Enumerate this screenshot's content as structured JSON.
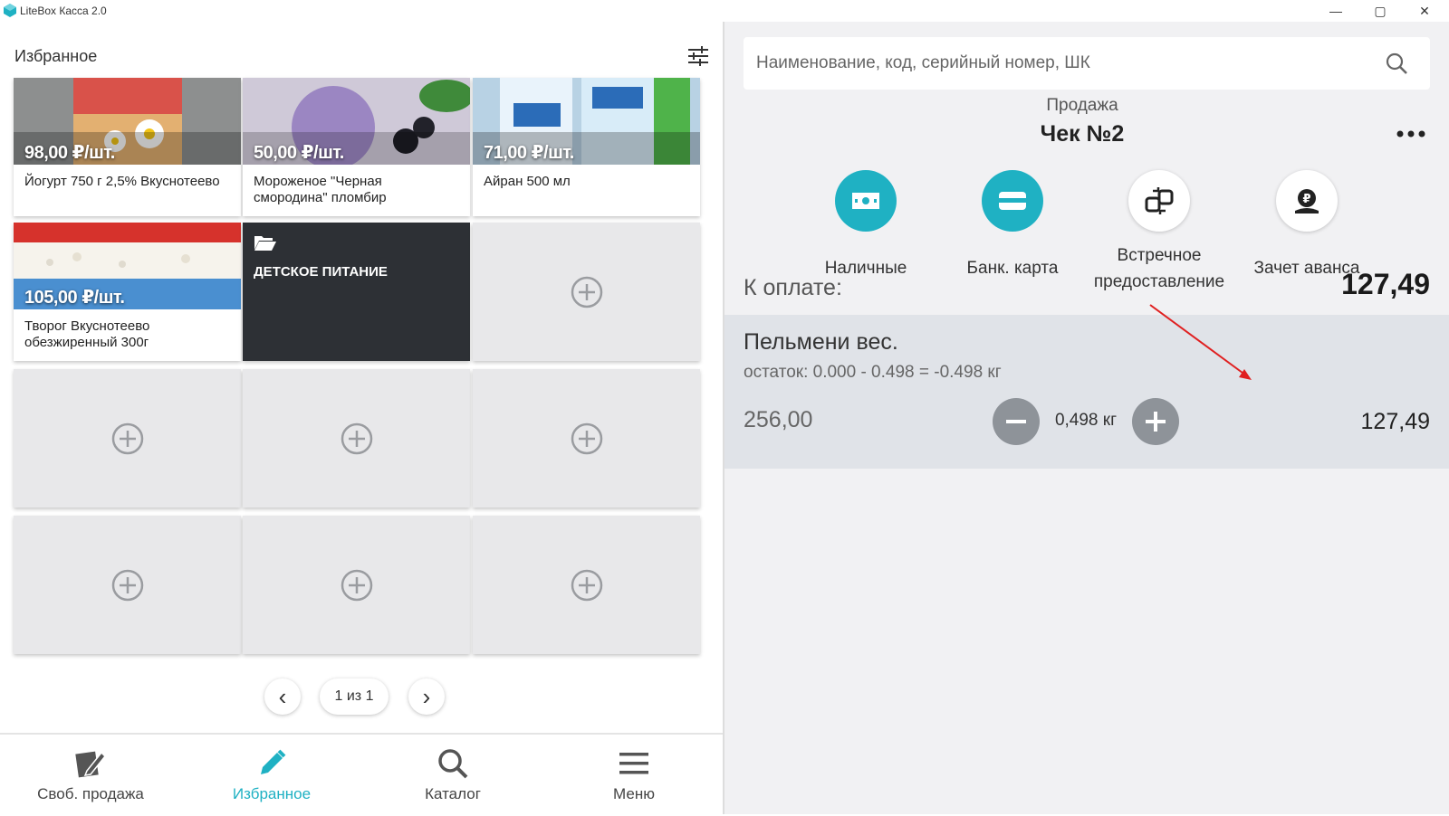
{
  "window": {
    "title": "LiteBox Касса 2.0",
    "minimize_glyph": "—",
    "maximize_glyph": "▢",
    "close_glyph": "✕",
    "accent": "#1fb1c3"
  },
  "favorites": {
    "title": "Избранное",
    "products": [
      {
        "price": "98,00 ₽/шт.",
        "name": "Йогурт 750 г 2,5% Вкуснотеево",
        "color": "#d9a36a"
      },
      {
        "price": "50,00 ₽/шт.",
        "name": "Мороженое \"Черная смородина\" пломбир",
        "color": "#9b86c2"
      },
      {
        "price": "71,00 ₽/шт.",
        "name": "Айран 500 мл",
        "color": "#4aa0d8"
      },
      {
        "price": "105,00 ₽/шт.",
        "name": "Творог Вкуснотеево обезжиренный 300г",
        "color": "#5b9bd5"
      }
    ],
    "folder": {
      "name": "ДЕТСКОЕ ПИТАНИЕ",
      "icon": "folder-open-icon"
    },
    "empty_slot_icon": "add-circle-icon"
  },
  "pager": {
    "prev_glyph": "‹",
    "info": "1 из 1",
    "next_glyph": "›"
  },
  "bottom_nav": [
    {
      "label": "Своб. продажа",
      "icon": "free-sale-icon",
      "active": false
    },
    {
      "label": "Избранное",
      "icon": "pencil-icon",
      "active": true
    },
    {
      "label": "Каталог",
      "icon": "search-icon",
      "active": false
    },
    {
      "label": "Меню",
      "icon": "menu-icon",
      "active": false
    }
  ],
  "search": {
    "placeholder": "Наименование, код, серийный номер, ШК"
  },
  "receipt": {
    "operation": "Продажа",
    "title": "Чек №2",
    "payment_methods": [
      {
        "label": "Наличные",
        "icon": "cash-icon"
      },
      {
        "label": "Банк. карта",
        "icon": "card-icon"
      },
      {
        "label": "Встречное предоставление",
        "icon": "exchange-icon"
      },
      {
        "label": "Зачет аванса",
        "icon": "advance-icon"
      }
    ],
    "to_pay_label": "К оплате:",
    "to_pay_amount": "127,49",
    "items": [
      {
        "name": "Пельмени вес.",
        "stock": "остаток: 0.000 - 0.498 = -0.498 кг",
        "price": "256,00",
        "quantity": "0,498 кг",
        "sum": "127,49"
      }
    ]
  }
}
